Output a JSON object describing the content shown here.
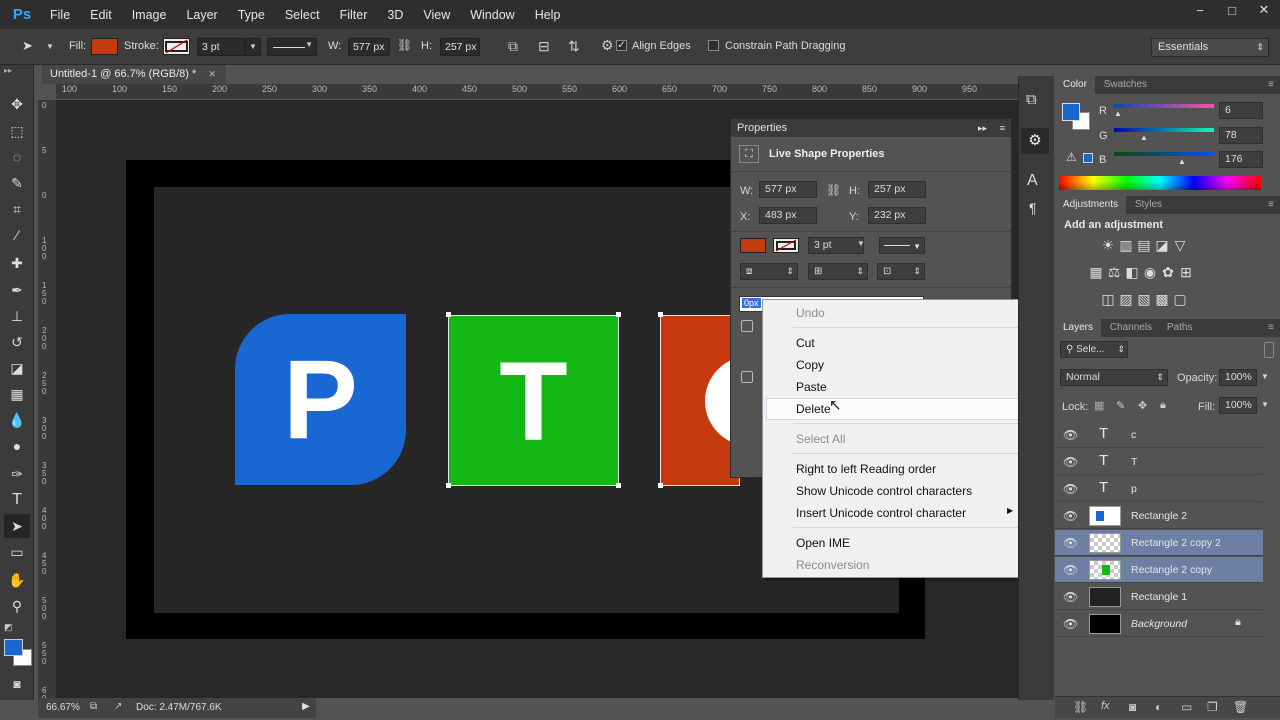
{
  "app": {
    "logo": "Ps"
  },
  "menu": [
    "File",
    "Edit",
    "Image",
    "Layer",
    "Type",
    "Select",
    "Filter",
    "3D",
    "View",
    "Window",
    "Help"
  ],
  "window_controls": {
    "minimize": "−",
    "maximize": "□",
    "close": "✕"
  },
  "options_bar": {
    "fill_label": "Fill:",
    "stroke_label": "Stroke:",
    "stroke_width": "3 pt",
    "w_label": "W:",
    "w_value": "577 px",
    "h_label": "H:",
    "h_value": "257 px",
    "align_edges": "Align Edges",
    "constrain": "Constrain Path Dragging",
    "workspace": "Essentials"
  },
  "colors": {
    "fill": "#c53a0f",
    "blue": "#1967d2",
    "green": "#14b814",
    "orange": "#c53a0f"
  },
  "document": {
    "tab_title": "Untitled-1 @ 66.7% (RGB/8) *",
    "ruler_h": [
      "100",
      "100",
      "150",
      "200",
      "250",
      "300",
      "350",
      "400",
      "450",
      "500",
      "550",
      "600",
      "650",
      "700",
      "750",
      "800",
      "850",
      "900",
      "950"
    ],
    "ruler_v": [
      "0",
      "5",
      "0",
      "1 0 0",
      "1 5 0",
      "2 0 0",
      "2 5 0",
      "3 0 0",
      "3 5 0",
      "4 0 0",
      "4 5 0",
      "5 0 0",
      "5 5 0",
      "6 0 0"
    ],
    "letters": [
      "P",
      "T"
    ],
    "zoom": "66.67%",
    "doc_size": "Doc: 2.47M/767.6K"
  },
  "properties": {
    "title": "Properties",
    "section": "Live Shape Properties",
    "w_label": "W:",
    "w": "577 px",
    "h_label": "H:",
    "h": "257 px",
    "x_label": "X:",
    "x": "483 px",
    "y_label": "Y:",
    "y": "232 px",
    "stroke": "3 pt",
    "radius_value": "0px"
  },
  "context_menu": {
    "undo": "Undo",
    "cut": "Cut",
    "copy": "Copy",
    "paste": "Paste",
    "delete": "Delete",
    "select_all": "Select All",
    "rtl": "Right to left Reading order",
    "show_unicode": "Show Unicode control characters",
    "insert_unicode": "Insert Unicode control character",
    "open_ime": "Open IME",
    "reconversion": "Reconversion"
  },
  "color_panel": {
    "tabs": [
      "Color",
      "Swatches"
    ],
    "r_label": "R",
    "r": "6",
    "g_label": "G",
    "g": "78",
    "b_label": "B",
    "b": "176"
  },
  "adjustments": {
    "tabs": [
      "Adjustments",
      "Styles"
    ],
    "heading": "Add an adjustment"
  },
  "layers_panel": {
    "tabs": [
      "Layers",
      "Channels",
      "Paths"
    ],
    "kind": "Sele...",
    "blend": "Normal",
    "opacity_label": "Opacity:",
    "opacity": "100%",
    "lock_label": "Lock:",
    "fill_label": "Fill:",
    "fill": "100%",
    "layers": [
      {
        "name": "c"
      },
      {
        "name": "T"
      },
      {
        "name": "p"
      },
      {
        "name": "Rectangle 2"
      },
      {
        "name": "Rectangle 2 copy 2"
      },
      {
        "name": "Rectangle 2 copy"
      },
      {
        "name": "Rectangle 1"
      },
      {
        "name": "Background"
      }
    ]
  }
}
